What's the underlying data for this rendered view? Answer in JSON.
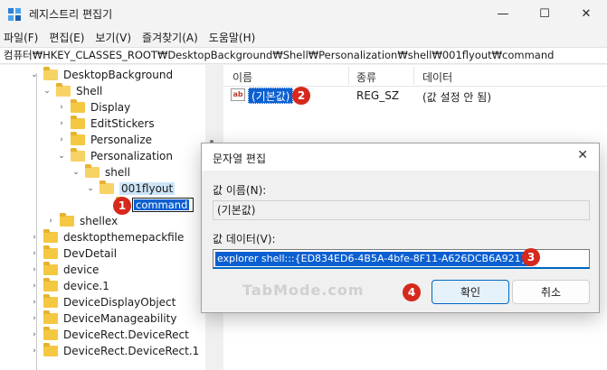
{
  "window": {
    "title": "레지스트리 편집기",
    "minimize_icon": "minimize-icon",
    "maximize_icon": "maximize-icon",
    "close_icon": "close-icon"
  },
  "menu": [
    "파일(F)",
    "편집(E)",
    "보기(V)",
    "즐겨찾기(A)",
    "도움말(H)"
  ],
  "address": "컴퓨터₩HKEY_CLASSES_ROOT₩DesktopBackground₩Shell₩Personalization₩shell₩001flyout₩command",
  "tree": [
    {
      "label": "DesktopBackground",
      "expanded": true
    },
    {
      "label": "Shell",
      "expanded": true
    },
    {
      "label": "Display",
      "expanded": false
    },
    {
      "label": "EditStickers",
      "expanded": false
    },
    {
      "label": "Personalize",
      "expanded": false
    },
    {
      "label": "Personalization",
      "expanded": true
    },
    {
      "label": "shell",
      "expanded": true
    },
    {
      "label": "001flyout",
      "expanded": true
    },
    {
      "label": "command",
      "editing": true
    },
    {
      "label": "shellex",
      "expanded": false
    },
    {
      "label": "desktopthemepackfile",
      "expanded": false
    },
    {
      "label": "DevDetail",
      "expanded": false
    },
    {
      "label": "device",
      "expanded": false
    },
    {
      "label": "device.1",
      "expanded": false
    },
    {
      "label": "DeviceDisplayObject",
      "expanded": false
    },
    {
      "label": "DeviceManageability",
      "expanded": false
    },
    {
      "label": "DeviceRect.DeviceRect",
      "expanded": false
    },
    {
      "label": "DeviceRect.DeviceRect.1",
      "expanded": false
    }
  ],
  "list": {
    "headers": {
      "name": "이름",
      "type": "종류",
      "data": "데이터"
    },
    "rows": [
      {
        "name": "(기본값)",
        "type": "REG_SZ",
        "data": "(값 설정 안 됨)",
        "icon": "string-value-icon"
      }
    ]
  },
  "dialog": {
    "title": "문자열 편집",
    "name_label": "값 이름(N):",
    "name_value": "(기본값)",
    "data_label": "값 데이터(V):",
    "data_value": "explorer shell:::{ED834ED6-4B5A-4bfe-8F11-A626DCB6A921}",
    "ok_label": "확인",
    "cancel_label": "취소"
  },
  "badges": {
    "b1": "1",
    "b2": "2",
    "b3": "3",
    "b4": "4"
  },
  "watermark": "TabMode.com",
  "colors": {
    "badge": "#d6281c",
    "selection": "#0b5fd1",
    "folder": "#f5c842"
  }
}
